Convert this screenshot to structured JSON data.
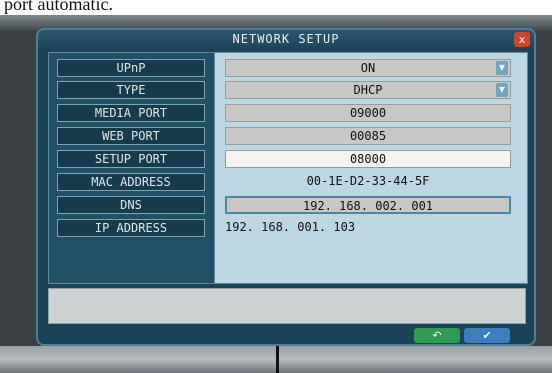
{
  "caption": {
    "text": "port automatic."
  },
  "dialog": {
    "title": "NETWORK SETUP",
    "close_label": "x"
  },
  "fields": [
    {
      "label": "UPnP",
      "value": "ON"
    },
    {
      "label": "TYPE",
      "value": "DHCP"
    },
    {
      "label": "MEDIA PORT",
      "value": "09000"
    },
    {
      "label": "WEB PORT",
      "value": "00085"
    },
    {
      "label": "SETUP PORT",
      "value": "08000"
    },
    {
      "label": "MAC ADDRESS",
      "value": "00-1E-D2-33-44-5F"
    },
    {
      "label": "DNS",
      "value": "192. 168. 002. 001"
    },
    {
      "label": "IP ADDRESS",
      "value": "192. 168. 001. 103"
    }
  ],
  "icons": {
    "dropdown": "chevron-down-icon",
    "back": "back-arrow-icon",
    "confirm": "check-icon"
  },
  "glyphs": {
    "dropdown": "▼",
    "back": "↶",
    "confirm": "✔"
  },
  "colors": {
    "dialog_bg": "#1a4357",
    "field_panel_bg": "#bcd6e3",
    "close_button": "#d4442b",
    "back_button": "#2f9a52",
    "ok_button": "#3b7fc0"
  }
}
